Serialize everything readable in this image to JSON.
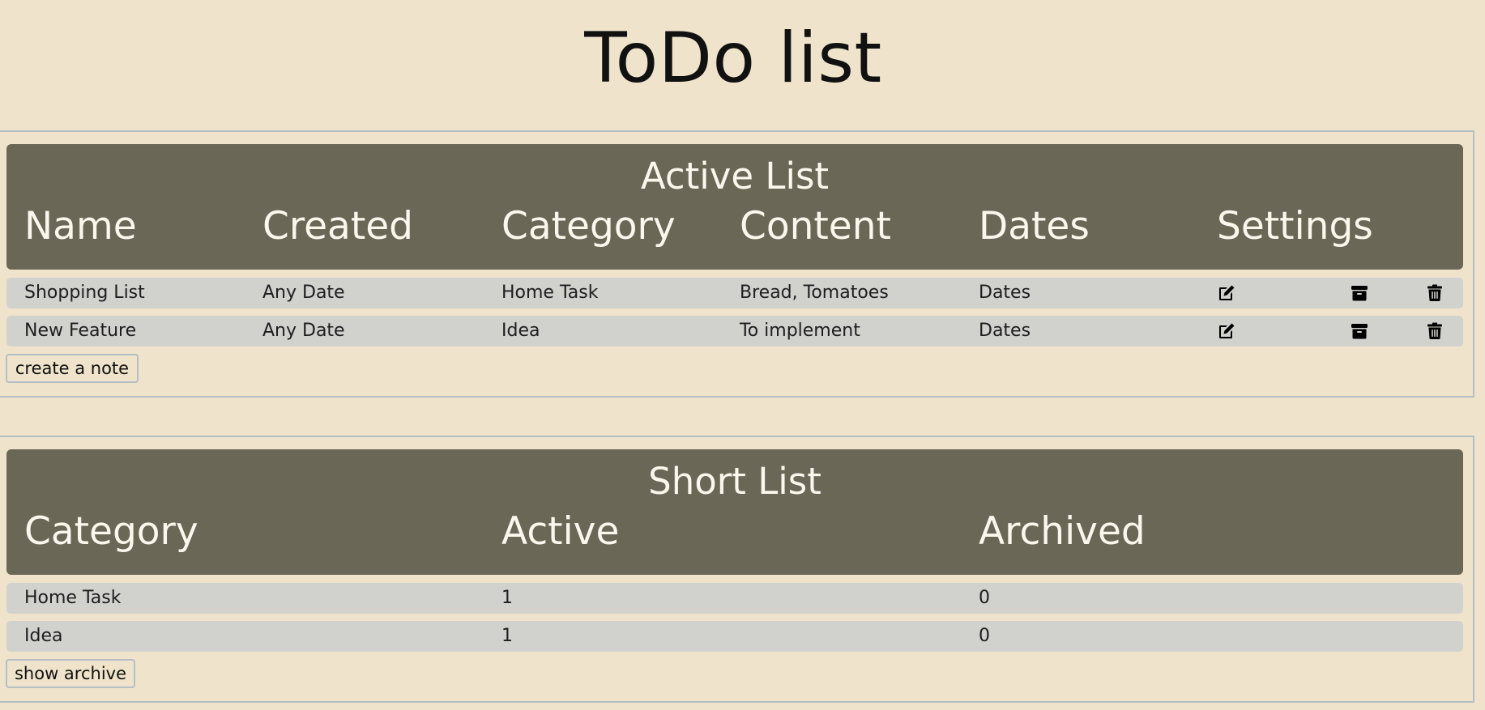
{
  "page": {
    "title": "ToDo list"
  },
  "active_list": {
    "heading": "Active List",
    "columns": [
      "Name",
      "Created",
      "Category",
      "Content",
      "Dates",
      "Settings"
    ],
    "rows": [
      {
        "name": "Shopping List",
        "created": "Any Date",
        "category": "Home Task",
        "content": "Bread, Tomatoes",
        "dates": "Dates",
        "settings_icons": [
          "edit-icon",
          "archive-icon",
          "trash-icon"
        ]
      },
      {
        "name": "New Feature",
        "created": "Any Date",
        "category": "Idea",
        "content": "To implement",
        "dates": "Dates",
        "settings_icons": [
          "edit-icon",
          "archive-icon",
          "trash-icon"
        ]
      }
    ],
    "create_button_label": "create a note"
  },
  "short_list": {
    "heading": "Short List",
    "columns": [
      "Category",
      "Active",
      "Archived"
    ],
    "rows": [
      {
        "category": "Home Task",
        "active": "1",
        "archived": "0"
      },
      {
        "category": "Idea",
        "active": "1",
        "archived": "0"
      }
    ],
    "archive_button_label": "show archive"
  },
  "colors": {
    "background": "#efe4cb",
    "header_background": "#6b6757",
    "header_text": "#fbf7ec",
    "row_background": "#d1d1ce",
    "panel_border": "#b4bec5"
  }
}
